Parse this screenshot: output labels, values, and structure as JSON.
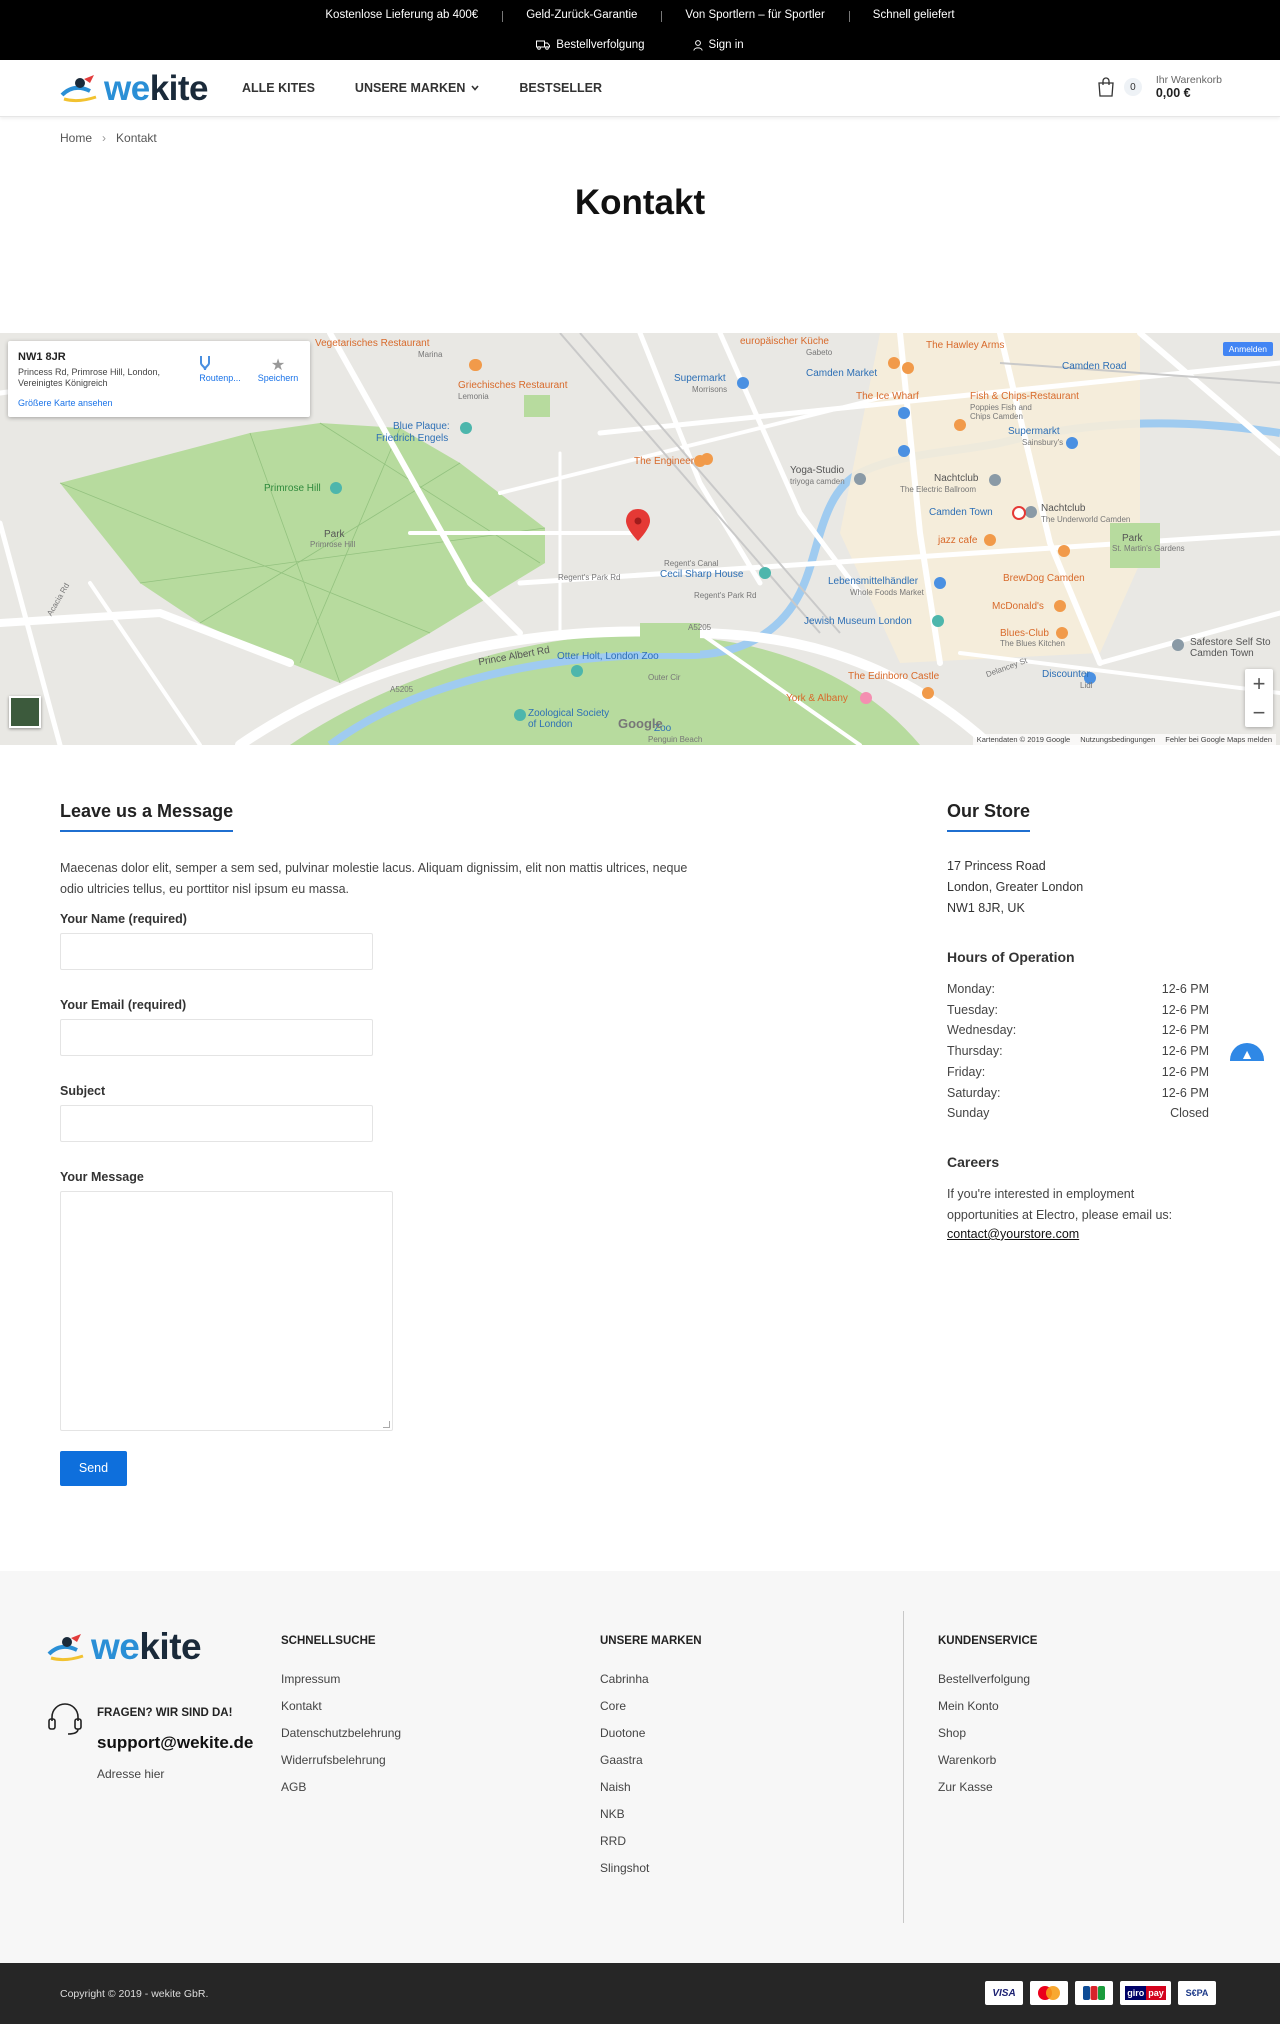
{
  "topbar": {
    "promos": [
      "Kostenlose Lieferung ab 400€",
      "Geld-Zurück-Garantie",
      "Von Sportlern – für Sportler",
      "Schnell geliefert"
    ],
    "tracking": "Bestellverfolgung",
    "signin": "Sign in"
  },
  "header": {
    "logo_we": "we",
    "logo_kite": "kite",
    "nav": [
      "ALLE KITES",
      "UNSERE MARKEN",
      "BESTSELLER"
    ],
    "cart_count": "0",
    "cart_label": "Ihr Warenkorb",
    "cart_total": "0,00 €"
  },
  "breadcrumb": {
    "home": "Home",
    "sep": "›",
    "current": "Kontakt"
  },
  "page_title": "Kontakt",
  "map": {
    "card_title": "NW1 8JR",
    "card_address": "Princess Rd, Primrose Hill, London, Vereinigtes Königreich",
    "card_link": "Größere Karte ansehen",
    "route_label": "Routenp...",
    "save_label": "Speichern",
    "signin_label": "Anmelden",
    "google": "Google",
    "footer_data": "Kartendaten © 2019 Google",
    "footer_terms": "Nutzungsbedingungen",
    "footer_report": "Fehler bei Google Maps melden",
    "labels": {
      "vegetarian": "Vegetarisches Restaurant",
      "marina": "Marina",
      "greek": "Griechisches Restaurant",
      "lemonia": "Lemonia",
      "blueplaque": "Blue Plaque:",
      "engels": "Friedrich Engels",
      "primrose": "Primrose Hill",
      "park": "Park",
      "parksub": "Primrose Hill",
      "engineer": "The Engineer",
      "supermarkt1": "Supermarkt",
      "morrisons": "Morrisons",
      "euro": "europäischer Küche",
      "gabeto": "Gabeto",
      "hawley": "The Hawley Arms",
      "camdenmarket": "Camden Market",
      "icewharf": "The Ice Wharf",
      "fishchips": "Fish & Chips-Restaurant",
      "poppies": "Poppies Fish and",
      "poppies2": "Chips Camden",
      "camdenroad": "Camden Road",
      "supermarkt2": "Supermarkt",
      "sainsburys": "Sainsbury's",
      "yoga": "Yoga-Studio",
      "triyoga": "triyoga camden",
      "nachtclub1": "Nachtclub",
      "ballroom": "The Electric Ballroom",
      "camdentown": "Camden Town",
      "nachtclub2": "Nachtclub",
      "underworld": "The Underworld Camden",
      "jazzcafe": "jazz cafe",
      "parkstmartins": "Park",
      "stmartins": "St. Martin's Gardens",
      "cecil": "Cecil Sharp House",
      "regentscanal": "Regent's Canal",
      "lebensmittel": "Lebensmittelhändler",
      "wholefoods": "Whole Foods Market",
      "brewdog": "BrewDog Camden",
      "mcdonalds": "McDonald's",
      "jewish": "Jewish Museum London",
      "bluesclub": "Blues-Club",
      "bluesclub2": "The Blues Kitchen",
      "safestore": "Safestore Self Sto",
      "safestore2": "Camden Town",
      "otter": "Otter Holt, London Zoo",
      "zoosoc": "Zoological Society",
      "zoosoc2": "of London",
      "zoo": "Zoo",
      "penguin": "Penguin Beach",
      "edinboro": "The Edinboro Castle",
      "york": "York & Albany",
      "discounter": "Discounter",
      "lidl": "Lidl",
      "princealbert": "Prince Albert Rd",
      "a5205": "A5205",
      "a5205b": "A5205",
      "regentspark": "Regent's Park Rd",
      "regentspark2": "Regent's Park Rd",
      "acacia": "Acacia Rd",
      "outercir": "Outer Cir",
      "delancey": "Delancey St"
    }
  },
  "form": {
    "heading": "Leave us a Message",
    "intro": "Maecenas dolor elit, semper a sem sed, pulvinar molestie lacus. Aliquam dignissim, elit non mattis ultrices, neque odio ultricies tellus, eu porttitor nisl ipsum eu massa.",
    "name_label": "Your Name (required)",
    "email_label": "Your Email (required)",
    "subject_label": "Subject",
    "message_label": "Your Message",
    "send_label": "Send"
  },
  "store": {
    "heading": "Our Store",
    "address_line1": "17 Princess Road",
    "address_line2": "London, Greater London",
    "address_line3": "NW1 8JR, UK",
    "hours_heading": "Hours of Operation",
    "hours": [
      {
        "day": "Monday:",
        "time": "12-6 PM"
      },
      {
        "day": "Tuesday:",
        "time": "12-6 PM"
      },
      {
        "day": "Wednesday:",
        "time": "12-6 PM"
      },
      {
        "day": "Thursday:",
        "time": "12-6 PM"
      },
      {
        "day": "Friday:",
        "time": "12-6 PM"
      },
      {
        "day": "Saturday:",
        "time": "12-6 PM"
      },
      {
        "day": "Sunday",
        "time": "Closed"
      }
    ],
    "careers_heading": "Careers",
    "careers_text": "If you're interested in employment opportunities at Electro, please email us:",
    "careers_email": "contact@yourstore.com"
  },
  "footer": {
    "help_title": "FRAGEN? WIR SIND DA!",
    "help_email": "support@wekite.de",
    "help_address": "Adresse hier",
    "col1_title": "SCHNELLSUCHE",
    "col1_items": [
      "Impressum",
      "Kontakt",
      "Datenschutzbelehrung",
      "Widerrufsbelehrung",
      "AGB"
    ],
    "col2_title": "UNSERE MARKEN",
    "col2_items": [
      "Cabrinha",
      "Core",
      "Duotone",
      "Gaastra",
      "Naish",
      "NKB",
      "RRD",
      "Slingshot"
    ],
    "col3_title": "KUNDENSERVICE",
    "col3_items": [
      "Bestellverfolgung",
      "Mein Konto",
      "Shop",
      "Warenkorb",
      "Zur Kasse"
    ],
    "copyright": "Copyright © 2019 - wekite GbR.",
    "payments": [
      "VISA",
      "giro",
      "pay",
      "S€PA"
    ]
  },
  "colors": {
    "accent": "#0e6fdc",
    "topbar": "#000000",
    "bottom": "#262626",
    "footer": "#f7f7f7"
  }
}
